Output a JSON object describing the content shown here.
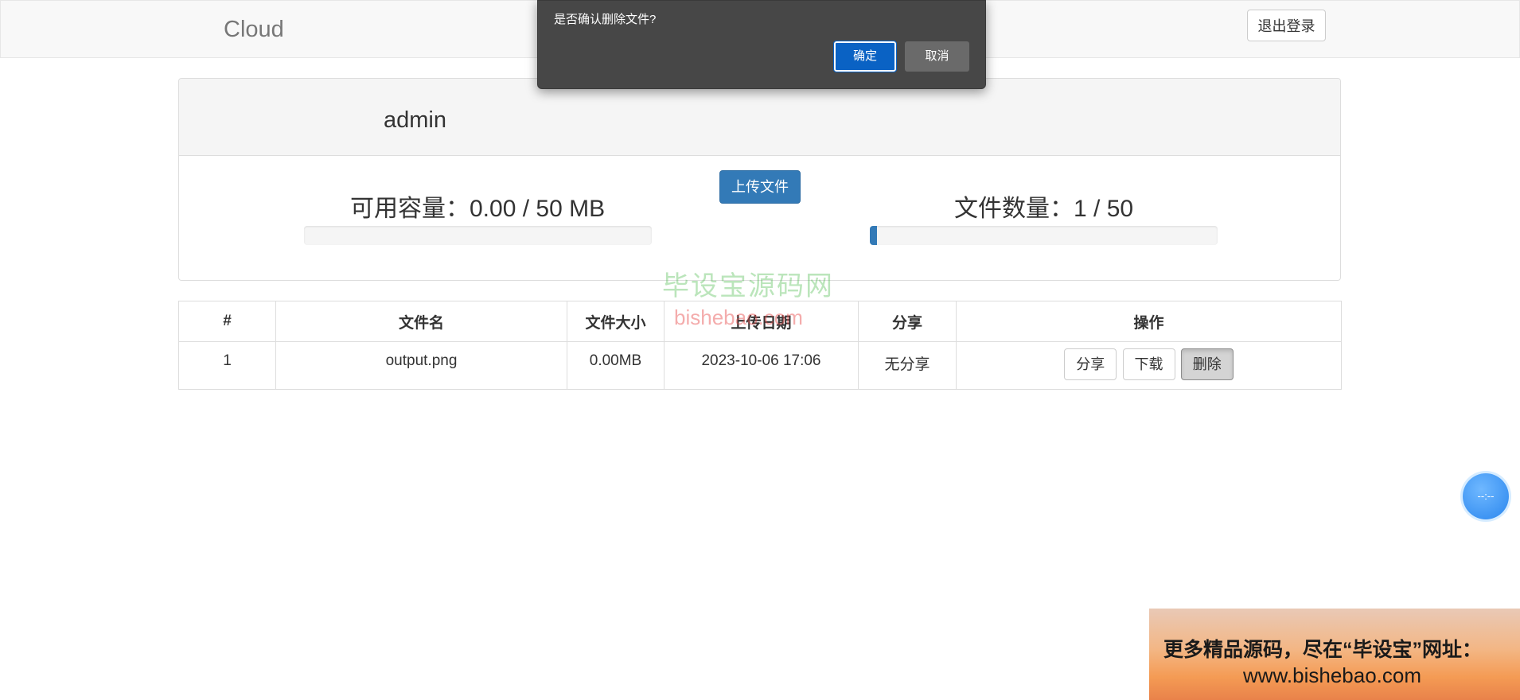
{
  "navbar": {
    "brand": "Cloud",
    "logout_label": "退出登录"
  },
  "profile": {
    "username": "admin",
    "upload_label": "上传文件",
    "capacity_label": "可用容量：0.00 / 50 MB",
    "capacity_progress": 0,
    "file_count_label": "文件数量：1 / 50",
    "file_count_progress": 0.02
  },
  "table": {
    "headers": [
      "#",
      "文件名",
      "文件大小",
      "上传日期",
      "分享",
      "操作"
    ],
    "rows": [
      {
        "index": "1",
        "name": "output.png",
        "size": "0.00MB",
        "date": "2023-10-06 17:06",
        "share": "无分享",
        "actions": [
          "分享",
          "下载",
          "删除"
        ]
      }
    ]
  },
  "dialog": {
    "message": "是否确认删除文件?",
    "ok_label": "确定",
    "cancel_label": "取消"
  },
  "watermark": {
    "cn": "毕设宝源码网",
    "en": "bishebao.com"
  },
  "float_ball": {
    "text": "--:--"
  },
  "ad": {
    "line1": "更多精品源码，尽在“毕设宝”网址：",
    "line2": "www.bishebao.com"
  },
  "colors": {
    "primary": "#337ab7",
    "dialog_bg": "#474747",
    "dialog_ok": "#0a62c4"
  }
}
